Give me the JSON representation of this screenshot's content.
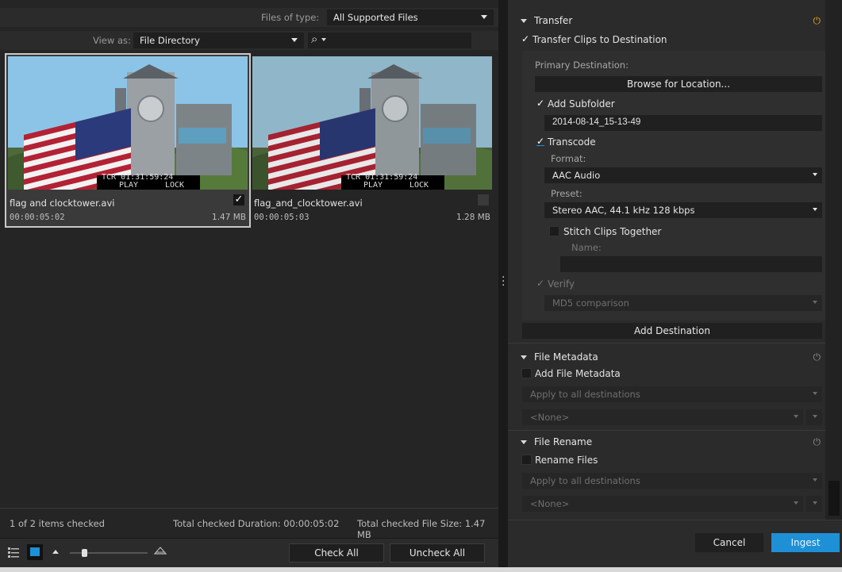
{
  "left": {
    "files_of_type_label": "Files of type:",
    "files_of_type_value": "All Supported Files",
    "view_as_label": "View as:",
    "view_as_value": "File Directory",
    "search_glyph": "⌕",
    "thumbnails": [
      {
        "name": "flag and clocktower.avi",
        "duration": "00:00:05:02",
        "size": "1.47 MB",
        "checked": true,
        "overlay_tc": "TCR 01:31:59:24",
        "overlay_play": "PLAY",
        "overlay_lock": "LOCK"
      },
      {
        "name": "flag_and_clocktower.avi",
        "duration": "00:00:05:03",
        "size": "1.28 MB",
        "checked": false,
        "overlay_tc": "TCR 01:31:59:24",
        "overlay_play": "PLAY",
        "overlay_lock": "LOCK"
      }
    ],
    "status": {
      "items_checked": "1 of 2 items checked",
      "total_duration": "Total checked Duration: 00:00:05:02",
      "total_size": "Total checked File Size: 1.47 MB"
    },
    "toolbar": {
      "check_all": "Check All",
      "uncheck_all": "Uncheck All",
      "zoom_level": 0.18
    }
  },
  "right": {
    "transfer": {
      "title": "Transfer",
      "transfer_clips": "Transfer Clips to Destination",
      "primary_destination_label": "Primary Destination:",
      "browse_button": "Browse for Location...",
      "add_subfolder": "Add Subfolder",
      "subfolder_value": "2014-08-14_15-13-49",
      "transcode": "Transcode",
      "format_label": "Format:",
      "format_value": "AAC Audio",
      "preset_label": "Preset:",
      "preset_value": "Stereo AAC, 44.1 kHz 128 kbps",
      "stitch_clips": "Stitch Clips Together",
      "name_label": "Name:",
      "verify": "Verify",
      "verify_method": "MD5 comparison",
      "add_destination": "Add Destination"
    },
    "file_metadata": {
      "title": "File Metadata",
      "add_file_metadata": "Add File Metadata",
      "apply_to": "Apply to all destinations",
      "template": "<None>"
    },
    "file_rename": {
      "title": "File Rename",
      "rename_files": "Rename Files",
      "apply_to": "Apply to all destinations",
      "template": "<None>"
    },
    "footer": {
      "cancel": "Cancel",
      "ingest": "Ingest"
    }
  },
  "colors": {
    "accent_blue": "#1e90d6",
    "power_on": "#e8a317"
  }
}
